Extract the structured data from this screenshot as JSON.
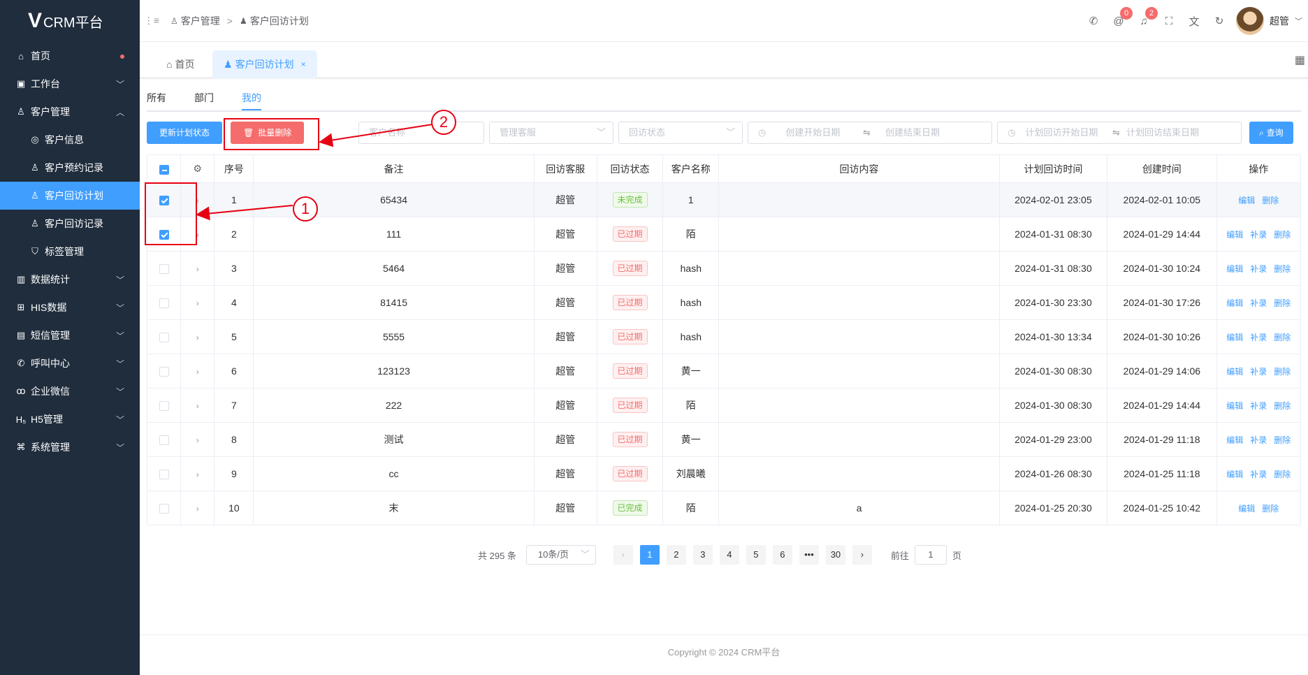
{
  "app": {
    "title": "CRM平台",
    "logo_mark": "V"
  },
  "sidebar": {
    "items": [
      {
        "label": "首页",
        "icon": "home-icon"
      },
      {
        "label": "工作台",
        "icon": "briefcase-icon"
      },
      {
        "label": "客户管理",
        "icon": "user-icon"
      },
      {
        "label": "客户信息",
        "icon": "shield-user-icon"
      },
      {
        "label": "客户预约记录",
        "icon": "user-icon"
      },
      {
        "label": "客户回访计划",
        "icon": "user-icon"
      },
      {
        "label": "客户回访记录",
        "icon": "user-icon"
      },
      {
        "label": "标签管理",
        "icon": "shield-icon"
      },
      {
        "label": "数据统计",
        "icon": "bar-chart-icon"
      },
      {
        "label": "HIS数据",
        "icon": "medical-kit-icon"
      },
      {
        "label": "短信管理",
        "icon": "message-icon"
      },
      {
        "label": "呼叫中心",
        "icon": "phone-icon"
      },
      {
        "label": "企业微信",
        "icon": "wechat-icon"
      },
      {
        "label": "H5管理",
        "icon": "h5-icon"
      },
      {
        "label": "系统管理",
        "icon": "command-icon"
      }
    ]
  },
  "breadcrumb": {
    "level1": "客户管理",
    "sep": ">",
    "level2": "客户回访计划"
  },
  "navbar": {
    "badge_mail": "0",
    "badge_bell": "2",
    "user": "超管"
  },
  "tags": {
    "home": "首页",
    "current": "客户回访计划",
    "close": "×"
  },
  "subtabs": [
    "所有",
    "部门",
    "我的"
  ],
  "toolbar": {
    "update_btn": "更新计划状态",
    "batch_delete_btn": "批量删除",
    "customer_name_ph": "客户名称",
    "manager_ph": "管理客服",
    "status_ph": "回访状态",
    "create_start_ph": "创建开始日期",
    "create_end_ph": "创建结束日期",
    "plan_start_ph": "计划回访开始日期",
    "plan_end_ph": "计划回访结束日期",
    "search_btn": "查询"
  },
  "table": {
    "headers": [
      "序号",
      "备注",
      "回访客服",
      "回访状态",
      "客户名称",
      "回访内容",
      "计划回访时间",
      "创建时间",
      "操作"
    ],
    "rows": [
      {
        "no": "1",
        "remark": "65434",
        "agent": "超管",
        "status": "未完成",
        "customer": "1",
        "content": "",
        "plan": "2024-02-01 23:05",
        "created": "2024-02-01 10:05"
      },
      {
        "no": "2",
        "remark": "111",
        "agent": "超管",
        "status": "已过期",
        "customer": "陌",
        "content": "",
        "plan": "2024-01-31 08:30",
        "created": "2024-01-29 14:44"
      },
      {
        "no": "3",
        "remark": "5464",
        "agent": "超管",
        "status": "已过期",
        "customer": "hash",
        "content": "",
        "plan": "2024-01-31 08:30",
        "created": "2024-01-30 10:24"
      },
      {
        "no": "4",
        "remark": "81415",
        "agent": "超管",
        "status": "已过期",
        "customer": "hash",
        "content": "",
        "plan": "2024-01-30 23:30",
        "created": "2024-01-30 17:26"
      },
      {
        "no": "5",
        "remark": "5555",
        "agent": "超管",
        "status": "已过期",
        "customer": "hash",
        "content": "",
        "plan": "2024-01-30 13:34",
        "created": "2024-01-30 10:26"
      },
      {
        "no": "6",
        "remark": "123123",
        "agent": "超管",
        "status": "已过期",
        "customer": "黄一",
        "content": "",
        "plan": "2024-01-30 08:30",
        "created": "2024-01-29 14:06"
      },
      {
        "no": "7",
        "remark": "222",
        "agent": "超管",
        "status": "已过期",
        "customer": "陌",
        "content": "",
        "plan": "2024-01-30 08:30",
        "created": "2024-01-29 14:44"
      },
      {
        "no": "8",
        "remark": "测试",
        "agent": "超管",
        "status": "已过期",
        "customer": "黄一",
        "content": "",
        "plan": "2024-01-29 23:00",
        "created": "2024-01-29 11:18"
      },
      {
        "no": "9",
        "remark": "cc",
        "agent": "超管",
        "status": "已过期",
        "customer": "刘晨曦",
        "content": "",
        "plan": "2024-01-26 08:30",
        "created": "2024-01-25 11:18"
      },
      {
        "no": "10",
        "remark": "末",
        "agent": "超管",
        "status": "已完成",
        "customer": "陌",
        "content": "a",
        "plan": "2024-01-25 20:30",
        "created": "2024-01-25 10:42"
      }
    ],
    "ops": {
      "edit": "编辑",
      "supplement": "补录",
      "delete": "删除"
    }
  },
  "pagination": {
    "total": "共 295 条",
    "size": "10条/页",
    "pages": [
      "1",
      "2",
      "3",
      "4",
      "5",
      "6",
      "•••",
      "30"
    ],
    "goto_label": "前往",
    "goto_value": "1",
    "page_unit": "页"
  },
  "footer": "Copyright © 2024 CRM平台",
  "annotations": {
    "one": "1",
    "two": "2"
  },
  "colors": {
    "primary": "#409eff",
    "danger": "#f56c6c",
    "sidebar": "#1f2d3d",
    "annotation": "#e60012"
  }
}
